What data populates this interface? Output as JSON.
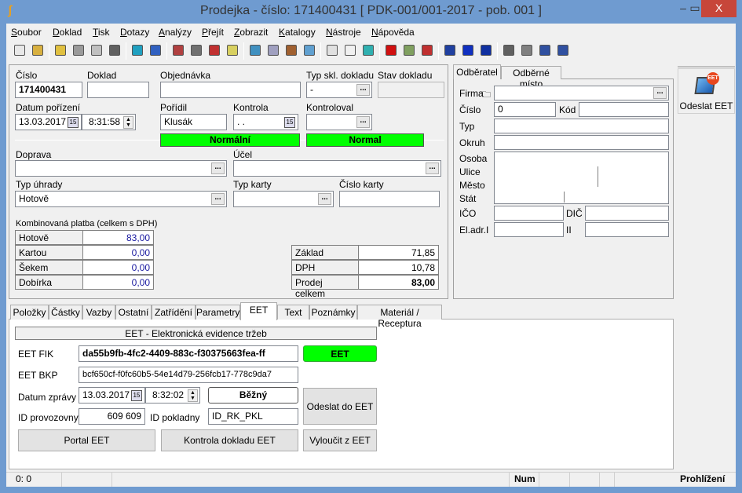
{
  "window": {
    "title": "Prodejka - číslo: 171400431  [ PDK-001/001-2017 - pob. 001 ]",
    "minimize": "‒",
    "maximize": "▭",
    "close": "X"
  },
  "menu": [
    "Soubor",
    "Doklad",
    "Tisk",
    "Dotazy",
    "Analýzy",
    "Přejít",
    "Zobrazit",
    "Katalogy",
    "Nástroje",
    "Nápověda"
  ],
  "toolbar": [
    {
      "icon": "new-document-icon",
      "color": "#e8e8e8"
    },
    {
      "icon": "open-folder-icon",
      "color": "#d8b040"
    },
    {
      "icon": "edit-folder-icon",
      "color": "#e0c040"
    },
    {
      "icon": "save-icon",
      "color": "#9a9a9a"
    },
    {
      "icon": "undo-icon",
      "color": "#c0c0c0"
    },
    {
      "icon": "delete-icon",
      "color": "#606060"
    },
    {
      "icon": "move-updown-icon",
      "color": "#20a0c0"
    },
    {
      "icon": "refresh-icon",
      "color": "#3060c0"
    },
    {
      "icon": "user-icon",
      "color": "#b04040"
    },
    {
      "icon": "printer-list-icon",
      "color": "#707070"
    },
    {
      "icon": "sms-icon",
      "color": "#c03030"
    },
    {
      "icon": "help-icon",
      "color": "#d8d060"
    },
    {
      "icon": "catalog-icon",
      "color": "#4090c0"
    },
    {
      "icon": "documents-icon",
      "color": "#a0a0c0"
    },
    {
      "icon": "package-icon",
      "color": "#a06030"
    },
    {
      "icon": "image-icon",
      "color": "#60a0d0"
    },
    {
      "icon": "copy-icon",
      "color": "#e0e0e0"
    },
    {
      "icon": "cube-icon",
      "color": "#f0f0f0"
    },
    {
      "icon": "cube-teal-icon",
      "color": "#30b0b0"
    },
    {
      "icon": "stop-icon",
      "color": "#d01010"
    },
    {
      "icon": "pen-icon",
      "color": "#80a060"
    },
    {
      "icon": "exit-icon",
      "color": "#c03030"
    },
    {
      "icon": "vat-list-icon",
      "color": "#2040a0"
    },
    {
      "icon": "dph-icon",
      "color": "#1030c0"
    },
    {
      "icon": "vies-icon",
      "color": "#1030a0"
    },
    {
      "icon": "print-icon",
      "color": "#606060"
    },
    {
      "icon": "print-preview-icon",
      "color": "#808080"
    },
    {
      "icon": "print-blue-icon",
      "color": "#3050a0"
    },
    {
      "icon": "print-setup-icon",
      "color": "#3050a0"
    }
  ],
  "header": {
    "cislo_label": "Číslo",
    "cislo": "171400431",
    "doklad_label": "Doklad",
    "doklad": "",
    "objednavka_label": "Objednávka",
    "objednavka": "",
    "typ_skl_label": "Typ skl. dokladu",
    "typ_skl": "-",
    "stav_label": "Stav dokladu",
    "stav": "",
    "datum_label": "Datum pořízení",
    "datum": "13.03.2017",
    "cas": "8:31:58",
    "poridil_label": "Pořídil",
    "poridil": "Klusák",
    "kontrola_label": "Kontrola",
    "kontrola": " .  .",
    "kontroloval_label": "Kontroloval",
    "kontroloval": "",
    "status1": "Normální",
    "status2": "Normal",
    "doprava_label": "Doprava",
    "doprava": "",
    "ucel_label": "Účel",
    "ucel": "",
    "typ_uhrady_label": "Typ úhrady",
    "typ_uhrady": "Hotově",
    "typ_karty_label": "Typ karty",
    "typ_karty": "",
    "cislo_karty_label": "Číslo karty",
    "cislo_karty": ""
  },
  "payment": {
    "title": "Kombinovaná platba (celkem s DPH)",
    "rows": [
      {
        "label": "Hotově",
        "value": "83,00"
      },
      {
        "label": "Kartou",
        "value": "0,00"
      },
      {
        "label": "Šekem",
        "value": "0,00"
      },
      {
        "label": "Dobírka",
        "value": "0,00"
      }
    ]
  },
  "totals": [
    {
      "label": "Základ",
      "value": "71,85"
    },
    {
      "label": "DPH",
      "value": "10,78"
    },
    {
      "label": "Prodej celkem",
      "value": "83,00"
    }
  ],
  "customer": {
    "tabs": [
      "Odběratel",
      "Odběrné místo"
    ],
    "firma_label": "Firma",
    "cislo_label": "Číslo",
    "cislo": "0",
    "kod_label": "Kód",
    "typ_label": "Typ",
    "okruh_label": "Okruh",
    "osoba_label": "Osoba",
    "ulice_label": "Ulice",
    "mesto_label": "Město",
    "stat_label": "Stát",
    "ico_label": "IČO",
    "dic_label": "DIČ",
    "eladr_label": "El.adr.I",
    "ii_label": "II"
  },
  "side": {
    "send_eet": "Odeslat EET",
    "badge": "EET"
  },
  "tabs": [
    "Položky",
    "Částky",
    "Vazby",
    "Ostatní",
    "Zatřídění",
    "Parametry",
    "EET",
    "Text",
    "Poznámky",
    "Materiál / Receptura"
  ],
  "eet": {
    "header": "EET - Elektronická evidence tržeb",
    "fik_label": "EET FIK",
    "fik": "da55b9fb-4fc2-4409-883c-f30375663fea-ff",
    "status": "EET",
    "bkp_label": "EET BKP",
    "bkp": "bcf650cf-f0fc60b5-54e14d79-256fcb17-778c9da7",
    "datum_label": "Datum zprávy",
    "datum": "13.03.2017",
    "cas": "8:32:02",
    "rezim": "Běžný",
    "odeslat": "Odeslat do EET",
    "provozovna_label": "ID provozovny",
    "provozovna": "609 609",
    "pokladna_label": "ID pokladny",
    "pokladna": "ID_RK_PKL",
    "portal": "Portal EET",
    "kontrola": "Kontrola dokladu EET",
    "vyloucit": "Vyloučit z EET"
  },
  "statusbar": {
    "pos": "0:   0",
    "num": "Num",
    "mode": "Prohlížení"
  }
}
